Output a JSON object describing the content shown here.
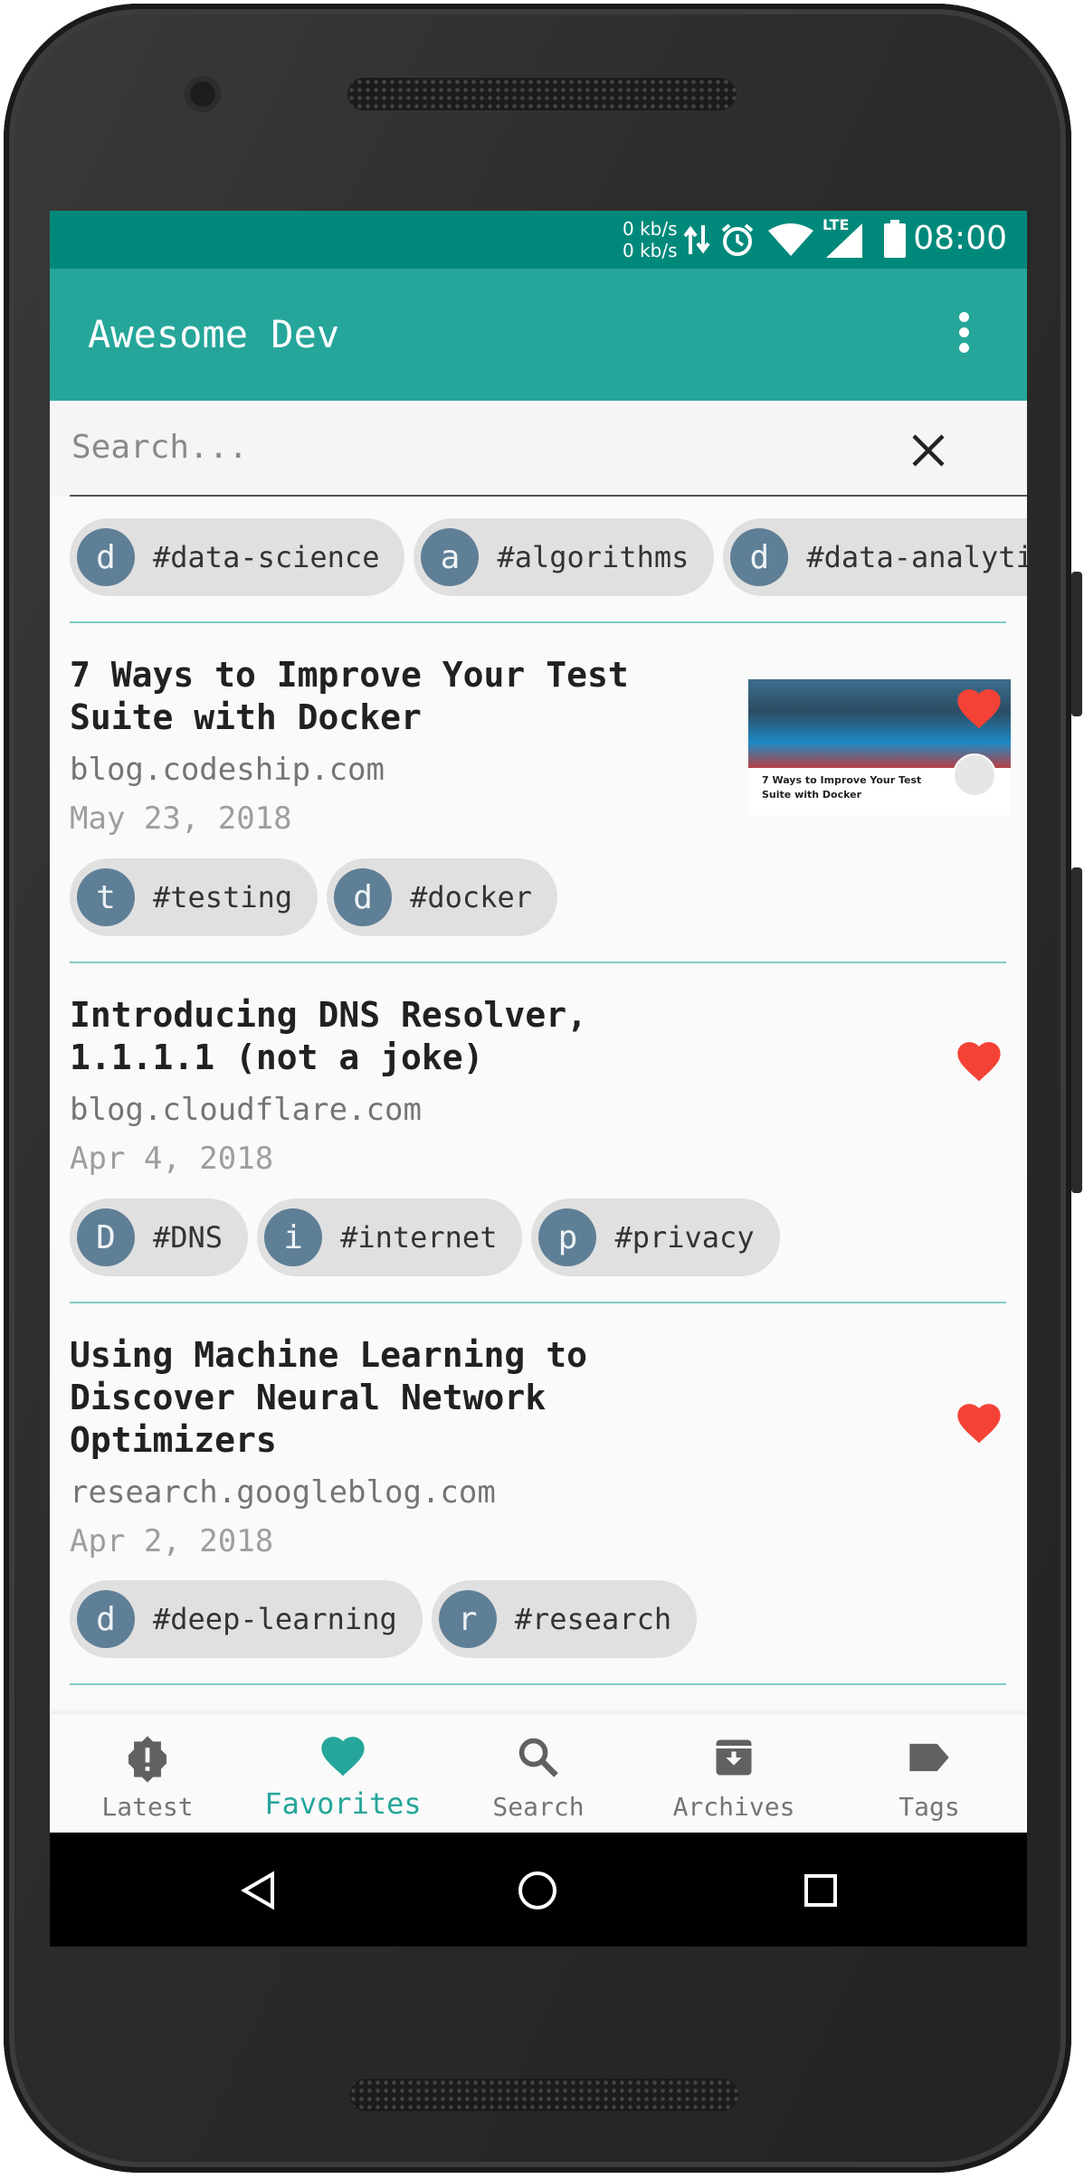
{
  "status": {
    "speed_up": "0 kb/s",
    "speed_down": "0 kb/s",
    "network": "LTE",
    "time": "08:00"
  },
  "appbar": {
    "title": "Awesome Dev",
    "menu_icon": "more-vert-icon"
  },
  "search": {
    "placeholder": "Search...",
    "value": ""
  },
  "top_tags": [
    {
      "initial": "d",
      "label": "#data-science"
    },
    {
      "initial": "a",
      "label": "#algorithms"
    },
    {
      "initial": "d",
      "label": "#data-analytics"
    }
  ],
  "articles": [
    {
      "title": "7 Ways to Improve Your Test Suite with Docker",
      "domain": "blog.codeship.com",
      "date": "May 23, 2018",
      "favorite": true,
      "thumbnail_caption": "7 Ways to Improve Your Test Suite with Docker",
      "tags": [
        {
          "initial": "t",
          "label": "#testing"
        },
        {
          "initial": "d",
          "label": "#docker"
        }
      ]
    },
    {
      "title": "Introducing DNS Resolver, 1.1.1.1 (not a joke)",
      "domain": "blog.cloudflare.com",
      "date": "Apr 4, 2018",
      "favorite": true,
      "tags": [
        {
          "initial": "D",
          "label": "#DNS"
        },
        {
          "initial": "i",
          "label": "#internet"
        },
        {
          "initial": "p",
          "label": "#privacy"
        }
      ]
    },
    {
      "title": "Using Machine Learning to Discover Neural Network Optimizers",
      "domain": "research.googleblog.com",
      "date": "Apr 2, 2018",
      "favorite": true,
      "tags": [
        {
          "initial": "d",
          "label": "#deep-learning"
        },
        {
          "initial": "r",
          "label": "#research"
        }
      ]
    }
  ],
  "bottom_nav": [
    {
      "label": "Latest",
      "icon": "alert-badge-icon",
      "active": false
    },
    {
      "label": "Favorites",
      "icon": "heart-icon",
      "active": true
    },
    {
      "label": "Search",
      "icon": "search-icon",
      "active": false
    },
    {
      "label": "Archives",
      "icon": "archive-icon",
      "active": false
    },
    {
      "label": "Tags",
      "icon": "label-icon",
      "active": false
    }
  ],
  "colors": {
    "primary": "#26a69a",
    "primary_dark": "#00897b",
    "heart": "#f44336",
    "chip_avatar": "#5f7f96"
  }
}
